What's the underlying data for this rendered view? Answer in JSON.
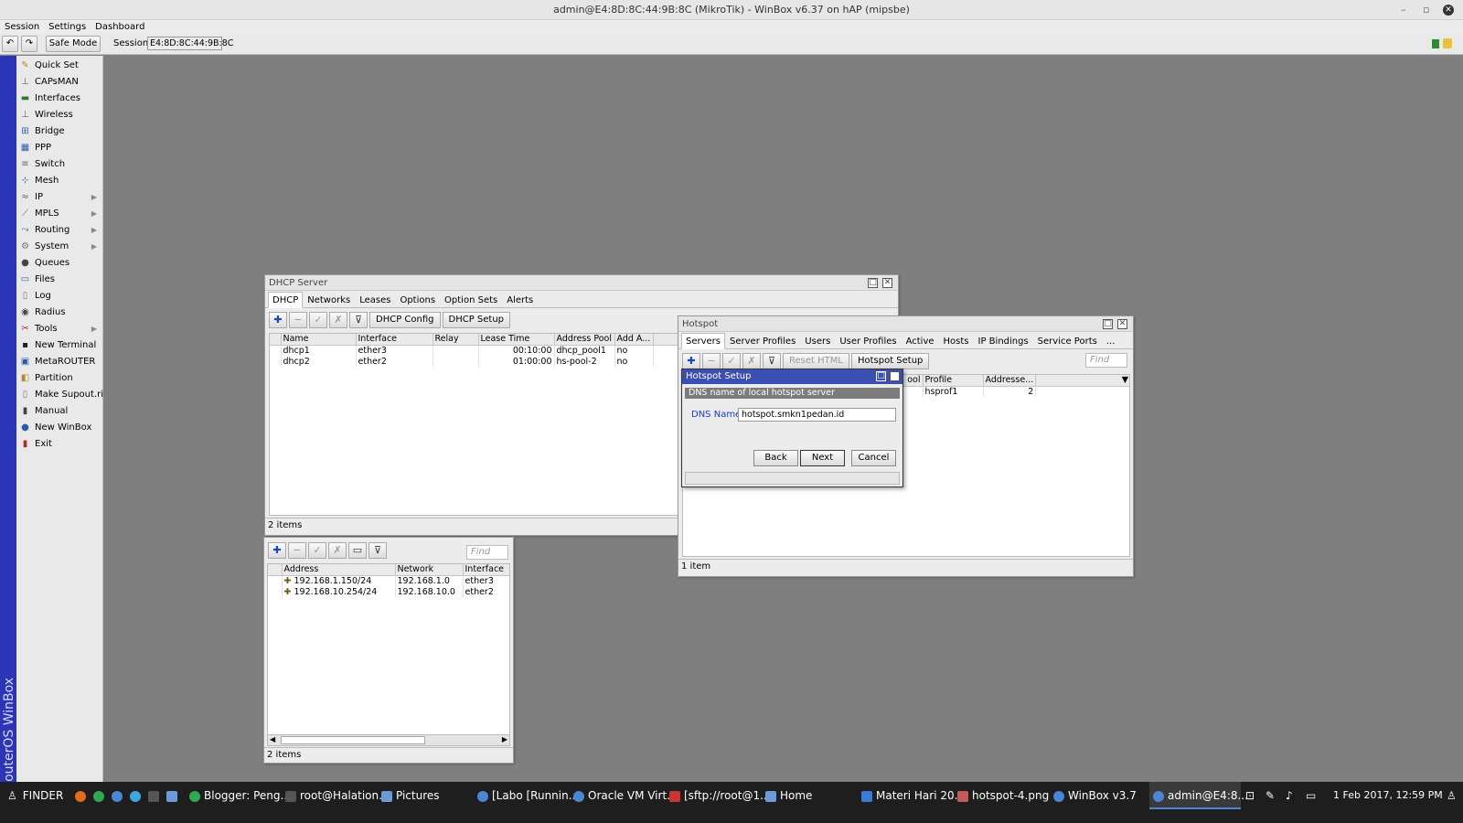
{
  "app": {
    "title": "admin@E4:8D:8C:44:9B:8C (MikroTik) - WinBox v6.37 on hAP (mipsbe)"
  },
  "menubar": {
    "items": [
      "Session",
      "Settings",
      "Dashboard"
    ]
  },
  "toolbar": {
    "safe_mode": "Safe Mode",
    "session_label": "Session:",
    "session_value": "E4:8D:8C:44:9B:8C"
  },
  "brand": "RouterOS WinBox",
  "sidebar": {
    "items": [
      {
        "label": "Quick Set",
        "icon": "quickset-icon"
      },
      {
        "label": "CAPsMAN",
        "icon": "capsman-icon"
      },
      {
        "label": "Interfaces",
        "icon": "interfaces-icon"
      },
      {
        "label": "Wireless",
        "icon": "wireless-icon"
      },
      {
        "label": "Bridge",
        "icon": "bridge-icon"
      },
      {
        "label": "PPP",
        "icon": "ppp-icon"
      },
      {
        "label": "Switch",
        "icon": "switch-icon"
      },
      {
        "label": "Mesh",
        "icon": "mesh-icon"
      },
      {
        "label": "IP",
        "icon": "ip-icon",
        "submenu": true
      },
      {
        "label": "MPLS",
        "icon": "mpls-icon",
        "submenu": true
      },
      {
        "label": "Routing",
        "icon": "routing-icon",
        "submenu": true
      },
      {
        "label": "System",
        "icon": "system-icon",
        "submenu": true
      },
      {
        "label": "Queues",
        "icon": "queues-icon"
      },
      {
        "label": "Files",
        "icon": "files-icon"
      },
      {
        "label": "Log",
        "icon": "log-icon"
      },
      {
        "label": "Radius",
        "icon": "radius-icon"
      },
      {
        "label": "Tools",
        "icon": "tools-icon",
        "submenu": true
      },
      {
        "label": "New Terminal",
        "icon": "terminal-icon"
      },
      {
        "label": "MetaROUTER",
        "icon": "metarouter-icon"
      },
      {
        "label": "Partition",
        "icon": "partition-icon"
      },
      {
        "label": "Make Supout.rif",
        "icon": "supout-icon"
      },
      {
        "label": "Manual",
        "icon": "manual-icon"
      },
      {
        "label": "New WinBox",
        "icon": "winbox-icon"
      },
      {
        "label": "Exit",
        "icon": "exit-icon"
      }
    ]
  },
  "dhcp": {
    "title": "DHCP Server",
    "tabs": [
      "DHCP",
      "Networks",
      "Leases",
      "Options",
      "Option Sets",
      "Alerts"
    ],
    "buttons": {
      "config": "DHCP Config",
      "setup": "DHCP Setup"
    },
    "columns": [
      "Name",
      "Interface",
      "Relay",
      "Lease Time",
      "Address Pool",
      "Add A..."
    ],
    "rows": [
      [
        "dhcp1",
        "ether3",
        "",
        "00:10:00",
        "dhcp_pool1",
        "no"
      ],
      [
        "dhcp2",
        "ether2",
        "",
        "01:00:00",
        "hs-pool-2",
        "no"
      ]
    ],
    "status": "2 items"
  },
  "addresses": {
    "find_placeholder": "Find",
    "columns": [
      "Address",
      "Network",
      "Interface"
    ],
    "rows": [
      [
        "192.168.1.150/24",
        "192.168.1.0",
        "ether3"
      ],
      [
        "192.168.10.254/24",
        "192.168.10.0",
        "ether2"
      ]
    ],
    "status": "2 items"
  },
  "hotspot": {
    "title": "Hotspot",
    "tabs": [
      "Servers",
      "Server Profiles",
      "Users",
      "User Profiles",
      "Active",
      "Hosts",
      "IP Bindings",
      "Service Ports",
      "..."
    ],
    "buttons": {
      "reset_html": "Reset HTML",
      "setup": "Hotspot Setup"
    },
    "find_placeholder": "Find",
    "columns": [
      "ool",
      "Profile",
      "Addresse..."
    ],
    "rows": [
      [
        "",
        "hsprof1",
        "2"
      ]
    ],
    "status": "1 item"
  },
  "setup": {
    "title": "Hotspot Setup",
    "section": "DNS name of local hotspot server",
    "dns_label": "DNS Name",
    "dns_value": "hotspot.smkn1pedan.id",
    "back": "Back",
    "next": "Next",
    "cancel": "Cancel"
  },
  "taskbar": {
    "start": "FINDER",
    "items": [
      {
        "label": "Blogger: Peng..."
      },
      {
        "label": "root@Halation..."
      },
      {
        "label": "Pictures"
      },
      {
        "label": "[Labo [Runnin..."
      },
      {
        "label": "Oracle VM Virt..."
      },
      {
        "label": "[sftp://root@1..."
      },
      {
        "label": "Home"
      },
      {
        "label": "Materi Hari 20..."
      },
      {
        "label": "hotspot-4.png"
      },
      {
        "label": "WinBox v3.7"
      },
      {
        "label": "admin@E4:8..."
      }
    ],
    "clock": "1 Feb 2017, 12:59 PM"
  },
  "colors": {
    "accent": "#2c35b5",
    "dialog_title": "#3b4fb2",
    "label_blue": "#1a3cc9"
  }
}
